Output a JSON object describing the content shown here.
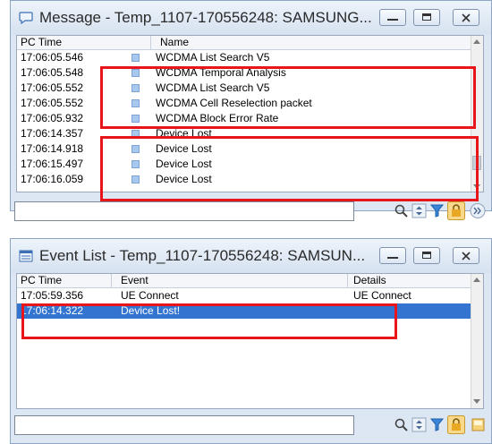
{
  "message_window": {
    "title": "Message - Temp_1107-170556248: SAMSUNG...",
    "columns": [
      "PC Time",
      "Name"
    ],
    "rows": [
      {
        "time": "17:06:05.546",
        "name": "WCDMA List Search V5"
      },
      {
        "time": "17:06:05.548",
        "name": "WCDMA Temporal Analysis"
      },
      {
        "time": "17:06:05.552",
        "name": "WCDMA List Search V5"
      },
      {
        "time": "17:06:05.552",
        "name": "WCDMA Cell Reselection packet"
      },
      {
        "time": "17:06:05.932",
        "name": "WCDMA Block Error Rate"
      },
      {
        "time": "17:06:14.357",
        "name": "Device Lost"
      },
      {
        "time": "17:06:14.918",
        "name": "Device Lost"
      },
      {
        "time": "17:06:15.497",
        "name": "Device Lost"
      },
      {
        "time": "17:06:16.059",
        "name": "Device Lost"
      }
    ]
  },
  "event_window": {
    "title": "Event List - Temp_1107-170556248: SAMSUN...",
    "columns": [
      "PC Time",
      "Event",
      "Details"
    ],
    "rows": [
      {
        "time": "17:05:59.356",
        "event": "UE Connect",
        "details": "UE Connect"
      },
      {
        "time": "17:06:14.322",
        "event": "Device Lost!",
        "details": ""
      }
    ],
    "selected_index": 1
  },
  "colors": {
    "highlight_box": "#e8151b",
    "selection": "#3374d1",
    "window_frame": "#dde7f3"
  }
}
